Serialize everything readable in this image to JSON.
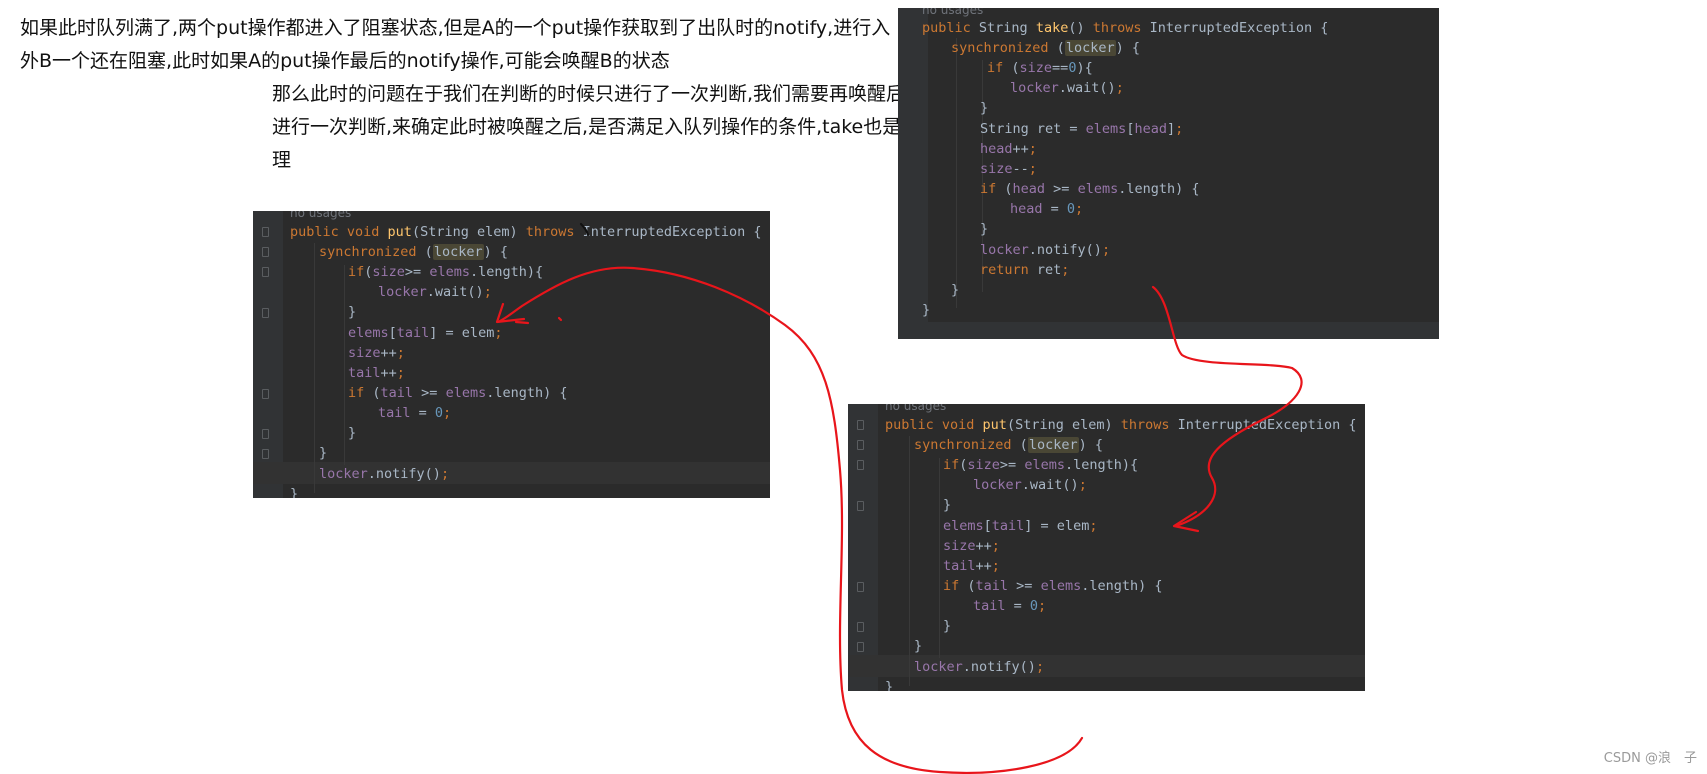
{
  "notes": {
    "line1": "如果此时队列满了,两个put操作都进入了阻塞状态,但是A的一个put操作获取到了出队时的notify,进行入",
    "line2": "外B一个还在阻塞,此时如果A的put操作最后的notify操作,可能会唤醒B的状态",
    "line3": "那么此时的问题在于我们在判断的时候只进行了一次判断,我们需要再唤醒后",
    "line4": "进行一次判断,来确定此时被唤醒之后,是否满足入队列操作的条件,take也是",
    "line5": "理"
  },
  "hints": {
    "usages": "no usages"
  },
  "code": {
    "put": {
      "l1": {
        "a": "public void ",
        "fn": "put",
        "b": "(String elem) ",
        "kw": "throws",
        "c": " InterruptedException {"
      },
      "l2": {
        "kw": "synchronized",
        "a": " (",
        "lk": "locker",
        "b": ") {"
      },
      "l3": {
        "kw": "if",
        "a": "(",
        "fd1": "size",
        "b": ">= ",
        "fd2": "elems",
        "c": ".length){"
      },
      "l4": {
        "fd": "locker",
        "a": ".wait()",
        "kw": ";"
      },
      "l5": "}",
      "l6": {
        "fd1": "elems",
        "a": "[",
        "fd2": "tail",
        "b": "] = elem",
        "kw": ";"
      },
      "l7": {
        "fd": "size",
        "a": "++",
        "kw": ";"
      },
      "l8": {
        "fd": "tail",
        "a": "++",
        "kw": ";"
      },
      "l9": {
        "kw": "if",
        "a": " (",
        "fd1": "tail",
        "b": " >= ",
        "fd2": "elems",
        "c": ".length) {"
      },
      "l10": {
        "fd": "tail",
        "a": " = ",
        "num": "0",
        "kw": ";"
      },
      "l11": "}",
      "l12": "}",
      "l13": {
        "fd": "locker",
        "a": ".notify()",
        "kw": ";"
      },
      "l14": "}"
    },
    "take": {
      "l1": {
        "kw1": "public",
        "a": " String ",
        "fn": "take",
        "b": "() ",
        "kw2": "throws",
        "c": " InterruptedException {"
      },
      "l2": {
        "kw": "synchronized",
        "a": " (",
        "lk": "locker",
        "b": ") {"
      },
      "l3": {
        "kw": "if",
        "a": " (",
        "fd": "size",
        "b": "==",
        "num": "0",
        "c": "){"
      },
      "l4": {
        "fd": "locker",
        "a": ".wait()",
        "kw": ";"
      },
      "l5": "}",
      "l6": {
        "a": "String ret = ",
        "fd1": "elems",
        "b": "[",
        "fd2": "head",
        "c": "]",
        "kw": ";"
      },
      "l7": {
        "fd": "head",
        "a": "++",
        "kw": ";"
      },
      "l8": {
        "fd": "size",
        "a": "--",
        "kw": ";"
      },
      "l9": {
        "kw": "if",
        "a": " (",
        "fd1": "head",
        "b": " >= ",
        "fd2": "elems",
        "c": ".length) {"
      },
      "l10": {
        "fd": "head",
        "a": " = ",
        "num": "0",
        "kw": ";"
      },
      "l11": "}",
      "l12": {
        "fd": "locker",
        "a": ".notify()",
        "kw": ";"
      },
      "l13": {
        "kw": "return",
        "a": " ret",
        "kw2": ";"
      },
      "l14": "}",
      "l15": "}"
    }
  },
  "watermark": "CSDN @浪　子",
  "colors": {
    "editor_bg": "#2b2b2b",
    "keyword": "#cc7832",
    "method": "#ffc66d",
    "field": "#9876aa",
    "number": "#6897bb",
    "annotation_red": "#e8151b"
  }
}
